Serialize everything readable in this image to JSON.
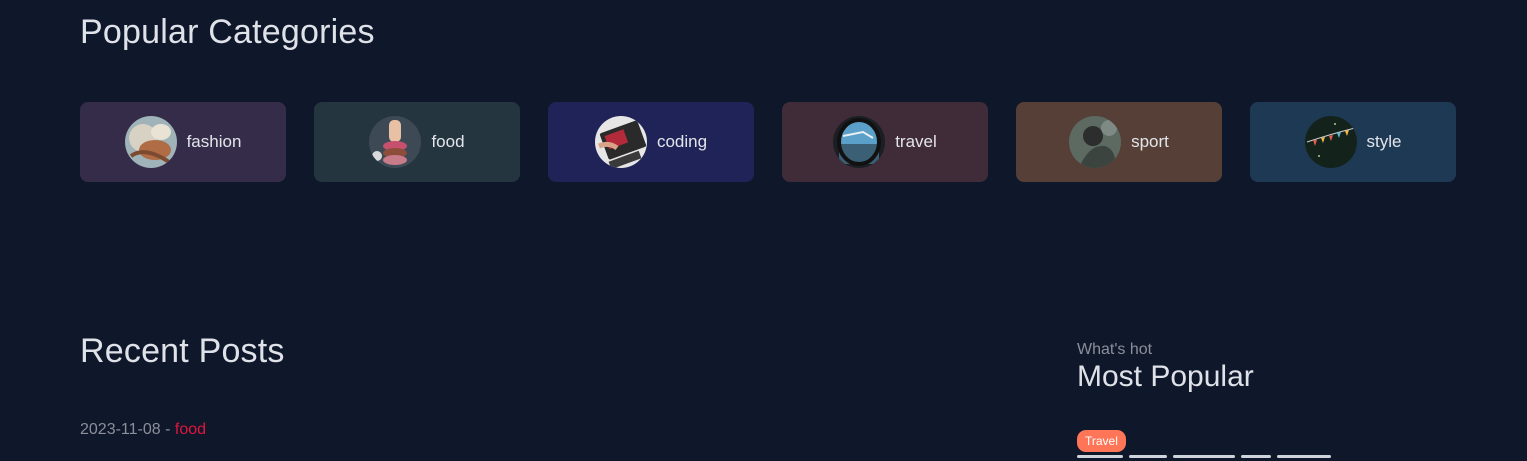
{
  "popular": {
    "title": "Popular Categories",
    "categories": [
      {
        "label": "fashion",
        "bg": "#352c4a",
        "icon": "fashion-thumbnail"
      },
      {
        "label": "food",
        "bg": "#24353f",
        "icon": "food-thumbnail"
      },
      {
        "label": "coding",
        "bg": "#202357",
        "icon": "coding-thumbnail"
      },
      {
        "label": "travel",
        "bg": "#3f2c38",
        "icon": "travel-thumbnail"
      },
      {
        "label": "sport",
        "bg": "#553f37",
        "icon": "sport-thumbnail"
      },
      {
        "label": "style",
        "bg": "#1e3954",
        "icon": "style-thumbnail"
      }
    ]
  },
  "recent": {
    "title": "Recent Posts",
    "post": {
      "date": "2023-11-08",
      "separator": " - ",
      "category": "food"
    }
  },
  "sidebar": {
    "subtitle": "What's hot",
    "title": "Most Popular",
    "badge": "Travel"
  },
  "colors": {
    "background": "#0f172a",
    "accent_red": "#e0173f",
    "badge": "#ff7557"
  }
}
